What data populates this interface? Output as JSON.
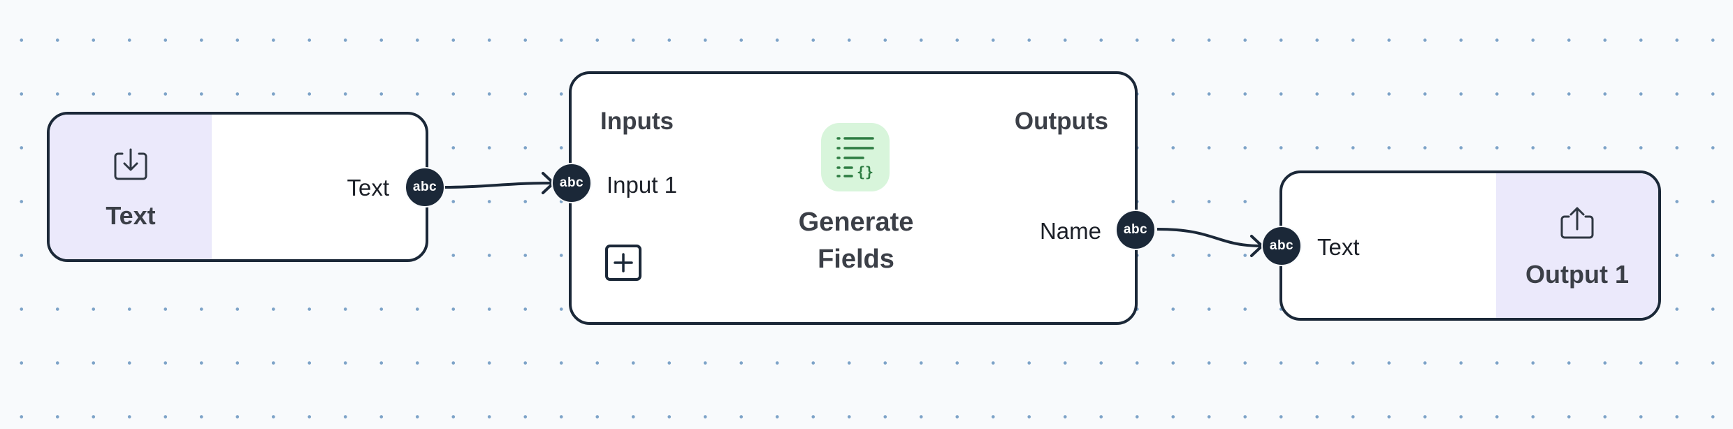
{
  "canvas": {
    "grid": "dotted",
    "dot_color": "#7da3c8",
    "background": "#f8fafc"
  },
  "text_input_node": {
    "panel_icon": "import-icon",
    "title": "Text",
    "output_label": "Text",
    "output_port": "abc",
    "panel_color": "#ebe9fb"
  },
  "generate_node": {
    "inputs_heading": "Inputs",
    "outputs_heading": "Outputs",
    "input_label": "Input 1",
    "input_port": "abc",
    "add_icon": "plus-icon",
    "center_icon": "list-json-icon",
    "center_icon_color": "#2e7d43",
    "center_icon_bg": "#d8f5db",
    "title_line1": "Generate",
    "title_line2": "Fields",
    "output_label": "Name",
    "output_port": "abc"
  },
  "output_node": {
    "input_label": "Text",
    "input_port": "abc",
    "panel_icon": "export-icon",
    "title": "Output 1",
    "panel_color": "#ebe9fb"
  },
  "connections": [
    {
      "from": "Text",
      "to": "Input 1"
    },
    {
      "from": "Name",
      "to": "Text"
    }
  ],
  "colors": {
    "node_border": "#1b2838",
    "port": "#1b2838",
    "heading": "#3b3f47"
  }
}
